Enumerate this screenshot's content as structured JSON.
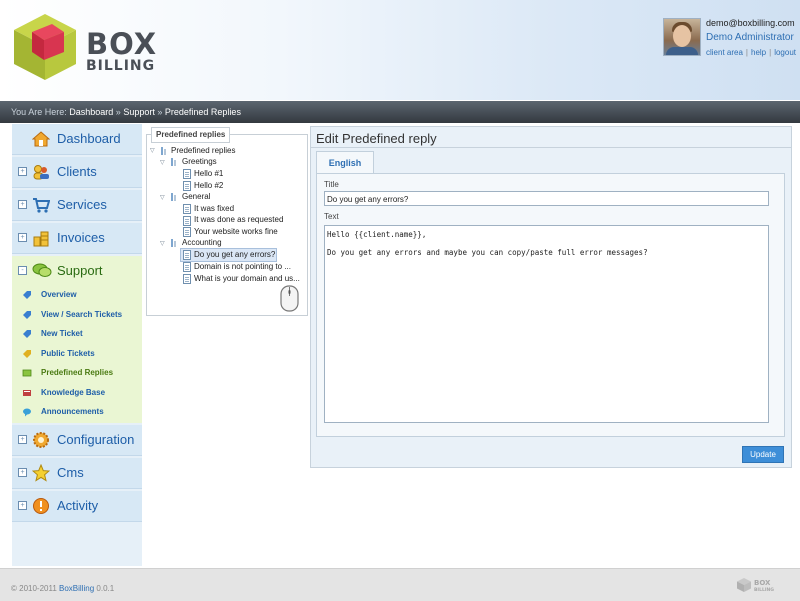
{
  "header": {
    "logo_top": "BOX",
    "logo_bottom": "BILLING",
    "user_email": "demo@boxbilling.com",
    "user_name": "Demo Administrator",
    "links": [
      "client area",
      "help",
      "logout"
    ]
  },
  "breadcrumb": {
    "prefix": "You Are Here:",
    "items": [
      "Dashboard",
      "Support",
      "Predefined Replies"
    ],
    "separator": "»"
  },
  "sidebar": {
    "items": [
      {
        "label": "Dashboard",
        "icon": "home-icon"
      },
      {
        "label": "Clients",
        "icon": "clients-icon"
      },
      {
        "label": "Services",
        "icon": "cart-icon"
      },
      {
        "label": "Invoices",
        "icon": "coins-icon"
      },
      {
        "label": "Support",
        "icon": "chat-icon"
      },
      {
        "label": "Configuration",
        "icon": "gear-icon"
      },
      {
        "label": "Cms",
        "icon": "star-icon"
      },
      {
        "label": "Activity",
        "icon": "alert-icon"
      }
    ],
    "support_sub": [
      {
        "label": "Overview",
        "icon": "tag-icon"
      },
      {
        "label": "View / Search Tickets",
        "icon": "tag-icon"
      },
      {
        "label": "New Ticket",
        "icon": "tag-icon"
      },
      {
        "label": "Public Tickets",
        "icon": "tag-icon"
      },
      {
        "label": "Predefined Replies",
        "icon": "reply-icon"
      },
      {
        "label": "Knowledge Base",
        "icon": "book-icon"
      },
      {
        "label": "Announcements",
        "icon": "bubble-icon"
      }
    ],
    "toggle_expand": "+",
    "toggle_collapse": "-"
  },
  "tree": {
    "legend": "Predefined replies",
    "root": "Predefined replies",
    "groups": [
      {
        "name": "Greetings",
        "items": [
          "Hello #1",
          "Hello #2"
        ]
      },
      {
        "name": "General",
        "items": [
          "It was fixed",
          "It was done as requested",
          "Your website works fine"
        ]
      },
      {
        "name": "Accounting",
        "items": [
          "Do you get any errors?",
          "Domain is not pointing to ...",
          "What is your domain and us..."
        ]
      }
    ],
    "selected": "Do you get any errors?",
    "arrow": "▽"
  },
  "editor": {
    "heading": "Edit Predefined reply",
    "tab": "English",
    "title_label": "Title",
    "title_value": "Do you get any errors?",
    "text_label": "Text",
    "text_value": "Hello {{client.name}},\n\nDo you get any errors and maybe you can copy/paste full error messages?",
    "update_button": "Update"
  },
  "footer": {
    "copyright": "© 2010-2011",
    "brand": "BoxBilling",
    "version": "0.0.1",
    "logo_top": "BOX",
    "logo_bottom": "BILLING"
  },
  "colors": {
    "accent": "#2e6fb3",
    "support_active": "#4a7a12",
    "button": "#3d8ed8"
  }
}
